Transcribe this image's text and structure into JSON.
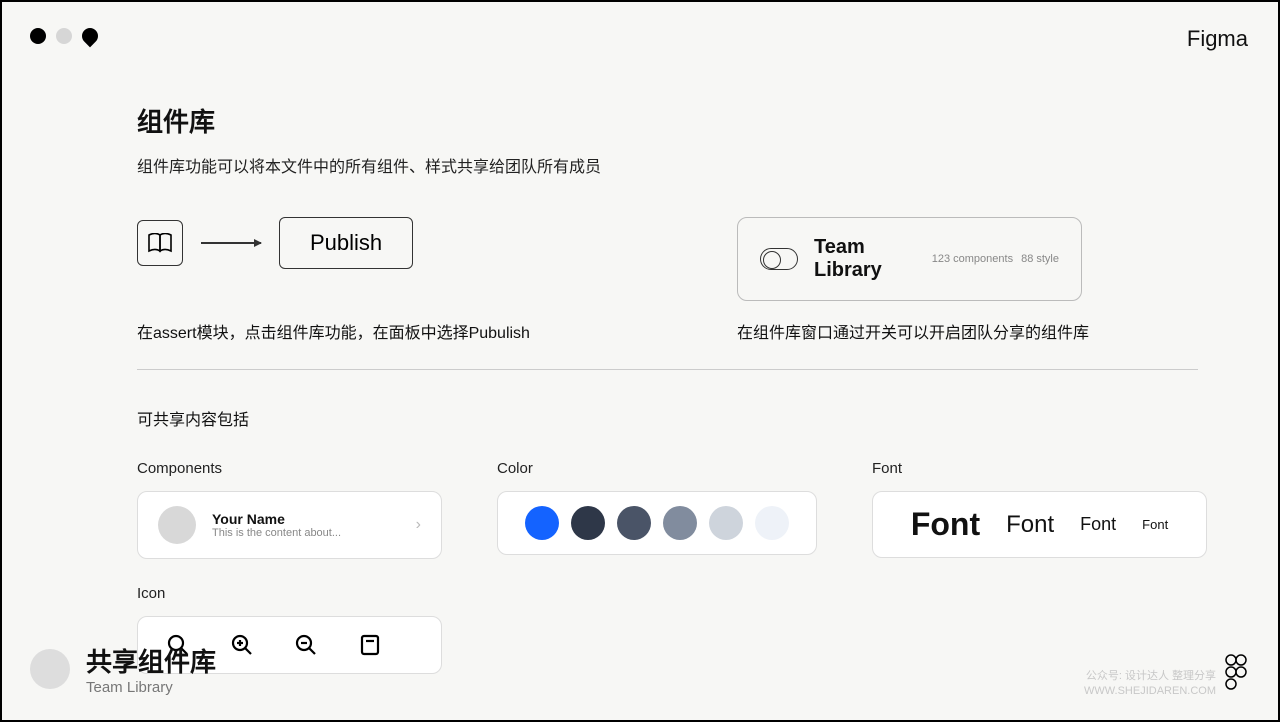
{
  "brand": "Figma",
  "header": {
    "title": "组件库",
    "subtitle": "组件库功能可以将本文件中的所有组件、样式共享给团队所有成员"
  },
  "flow": {
    "publish_label": "Publish",
    "publish_caption": "在assert模块，点击组件库功能，在面板中选择Pubulish"
  },
  "team_library": {
    "label": "Team Library",
    "stats_components": "123 components",
    "stats_style": "88 style",
    "caption": "在组件库窗口通过开关可以开启团队分享的组件库"
  },
  "shareable": {
    "heading": "可共享内容包括",
    "components": {
      "label": "Components",
      "name": "Your Name",
      "sub": "This is the content about..."
    },
    "color": {
      "label": "Color",
      "swatches": [
        "#1463FF",
        "#2E3748",
        "#4A5467",
        "#818C9E",
        "#CED4DC",
        "#EEF2F8"
      ]
    },
    "font": {
      "label": "Font",
      "samples": [
        "Font",
        "Font",
        "Font",
        "Font"
      ]
    },
    "icon": {
      "label": "Icon"
    }
  },
  "footer": {
    "title": "共享组件库",
    "sub": "Team Library"
  },
  "watermark": {
    "l1": "公众号: 设计达人 整理分享",
    "l2": "WWW.SHEJIDAREN.COM"
  }
}
